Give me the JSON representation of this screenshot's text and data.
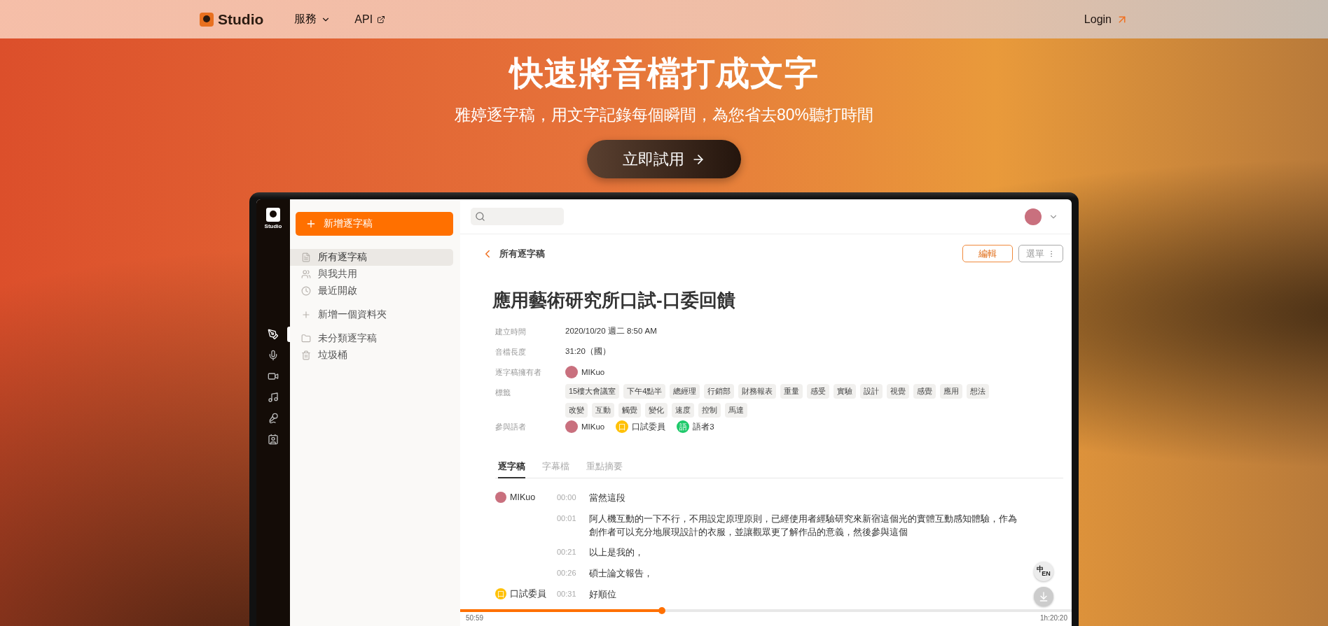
{
  "nav": {
    "logo": "Studio",
    "items": [
      {
        "label": "服務",
        "kind": "dropdown"
      },
      {
        "label": "API",
        "kind": "external"
      }
    ],
    "login": "Login"
  },
  "hero": {
    "title": "快速將音檔打成文字",
    "subtitle": "雅婷逐字稿，用文字記錄每個瞬間，為您省去80%聽打時間",
    "cta": "立即試用"
  },
  "app": {
    "rail": {
      "logo": "Studio",
      "items": [
        {
          "selected": true
        },
        {
          "selected": false
        },
        {
          "selected": false
        },
        {
          "selected": false
        },
        {
          "selected": false
        },
        {
          "selected": false
        }
      ]
    },
    "sidebar": {
      "new_button": "新增逐字稿",
      "items": [
        {
          "label": "所有逐字稿",
          "selected": true
        },
        {
          "label": "與我共用",
          "selected": false
        },
        {
          "label": "最近開啟",
          "selected": false
        }
      ],
      "add_folder": "新增一個資料夾",
      "folders": [
        {
          "label": "未分類逐字稿"
        },
        {
          "label": "垃圾桶"
        }
      ]
    },
    "document": {
      "back": "所有逐字稿",
      "edit_button": "編輯",
      "menu_button": "選單",
      "title": "應用藝術研究所口試-口委回饋",
      "meta": [
        {
          "kind": "text",
          "label": "建立時間",
          "value": "2020/10/20 週二  8:50 AM"
        },
        {
          "kind": "text",
          "label": "音檔長度",
          "value": "31:20（國）"
        },
        {
          "kind": "people",
          "label": "逐字稿擁有者",
          "people": [
            {
              "name": "MIKuo",
              "color": "#c9707e"
            }
          ]
        },
        {
          "kind": "tags",
          "label": "標籤",
          "tags": [
            "15樓大會議室",
            "下午4點半",
            "總經理",
            "行銷部",
            "財務報表",
            "重量",
            "感受",
            "實驗",
            "設計",
            "視覺",
            "感覺",
            "應用",
            "想法",
            "改變",
            "互動",
            "觸覺",
            "變化",
            "速度",
            "控制",
            "馬達"
          ]
        },
        {
          "kind": "people",
          "label": "參與語者",
          "people": [
            {
              "name": "MIKuo",
              "color": "#c9707e"
            },
            {
              "name": "口試委員",
              "badge": "口",
              "color": "#ffc107"
            },
            {
              "name": "語者3",
              "badge": "語",
              "color": "#1ec96a"
            }
          ]
        }
      ],
      "tabs": [
        {
          "label": "逐字稿",
          "selected": true
        },
        {
          "label": "字幕檔",
          "selected": false
        },
        {
          "label": "重點摘要",
          "selected": false
        }
      ],
      "transcript": [
        {
          "speaker": {
            "name": "MIKuo",
            "color": "#c9707e"
          },
          "time": "00:00",
          "text": "當然這段"
        },
        {
          "time": "00:01",
          "text": "阿人機互動的一下不行，不用設定原理原則，已經使用者經驗研究來新宿這個光的實體互動感知體驗，作為創作者可以充分地展現設計的衣服，並讓觀眾更了解作品的意義，然後參與這個"
        },
        {
          "time": "00:21",
          "text": "以上是我的，"
        },
        {
          "time": "00:26",
          "text": "碩士論文報告，"
        },
        {
          "speaker": {
            "name": "口試委員",
            "badge": "口",
            "color": "#ffc107"
          },
          "time": "00:31",
          "text": "好順位"
        }
      ],
      "translate": {
        "zh": "中",
        "en": "EN"
      },
      "player": {
        "level": 0.33,
        "elapsed": "50:59",
        "total": "1h:20:20"
      }
    }
  }
}
